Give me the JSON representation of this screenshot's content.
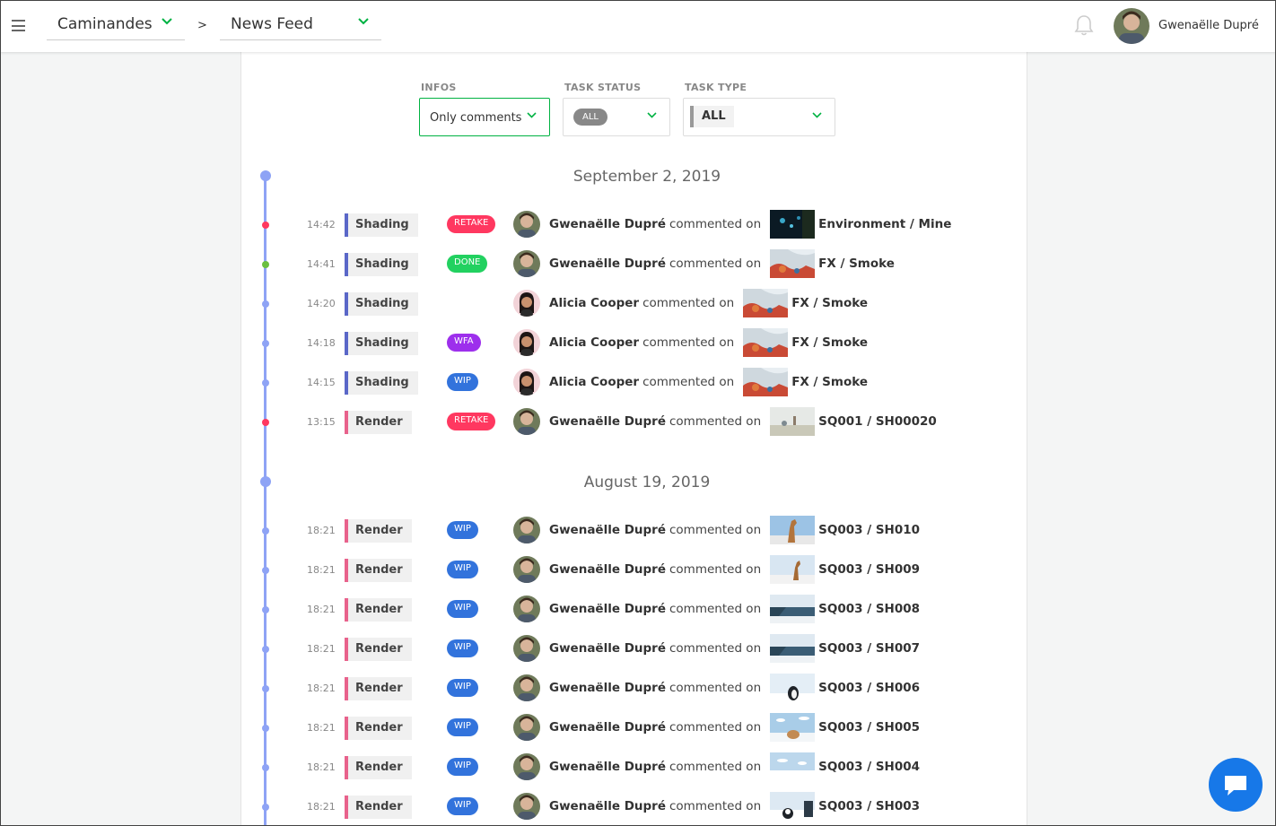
{
  "topbar": {
    "project": "Caminandes",
    "separator": ">",
    "section": "News Feed",
    "user_name": "Gwenaëlle Dupré"
  },
  "filters": {
    "infos": {
      "label": "INFOS",
      "value": "Only comments"
    },
    "task_status": {
      "label": "TASK STATUS",
      "value": "ALL"
    },
    "task_type": {
      "label": "TASK TYPE",
      "value": "ALL"
    }
  },
  "colors": {
    "accent": "#00b242",
    "timeline": "#8ea3f5",
    "shading": "#5a67c8",
    "render": "#e8628c",
    "retake": "#ff3860",
    "done": "#22d160",
    "wfa": "#9d2fec",
    "wip": "#3273dc",
    "chat": "#1778e8"
  },
  "groups": [
    {
      "date": "September 2, 2019",
      "items": [
        {
          "time": "14:42",
          "task": "Shading",
          "task_type": "shading",
          "status": "RETAKE",
          "status_key": "retake",
          "author": "Gwenaëlle Dupré",
          "author_key": "gwen",
          "verb": "commented on",
          "entity": "Environment / Mine",
          "thumb": "mine"
        },
        {
          "time": "14:41",
          "task": "Shading",
          "task_type": "shading",
          "status": "DONE",
          "status_key": "done",
          "author": "Gwenaëlle Dupré",
          "author_key": "gwen",
          "verb": "commented on",
          "entity": "FX / Smoke",
          "thumb": "smoke"
        },
        {
          "time": "14:20",
          "task": "Shading",
          "task_type": "shading",
          "status": "",
          "status_key": "",
          "author": "Alicia Cooper",
          "author_key": "alicia",
          "verb": "commented on",
          "entity": "FX / Smoke",
          "thumb": "smoke"
        },
        {
          "time": "14:18",
          "task": "Shading",
          "task_type": "shading",
          "status": "WFA",
          "status_key": "wfa",
          "author": "Alicia Cooper",
          "author_key": "alicia",
          "verb": "commented on",
          "entity": "FX / Smoke",
          "thumb": "smoke"
        },
        {
          "time": "14:15",
          "task": "Shading",
          "task_type": "shading",
          "status": "WIP",
          "status_key": "wip",
          "author": "Alicia Cooper",
          "author_key": "alicia",
          "verb": "commented on",
          "entity": "FX / Smoke",
          "thumb": "smoke"
        },
        {
          "time": "13:15",
          "task": "Render",
          "task_type": "render",
          "status": "RETAKE",
          "status_key": "retake",
          "author": "Gwenaëlle Dupré",
          "author_key": "gwen",
          "verb": "commented on",
          "entity": "SQ001 / SH00020",
          "thumb": "snow"
        }
      ]
    },
    {
      "date": "August 19, 2019",
      "items": [
        {
          "time": "18:21",
          "task": "Render",
          "task_type": "render",
          "status": "WIP",
          "status_key": "wip",
          "author": "Gwenaëlle Dupré",
          "author_key": "gwen",
          "verb": "commented on",
          "entity": "SQ003 / SH010",
          "thumb": "llama"
        },
        {
          "time": "18:21",
          "task": "Render",
          "task_type": "render",
          "status": "WIP",
          "status_key": "wip",
          "author": "Gwenaëlle Dupré",
          "author_key": "gwen",
          "verb": "commented on",
          "entity": "SQ003 / SH009",
          "thumb": "llama2"
        },
        {
          "time": "18:21",
          "task": "Render",
          "task_type": "render",
          "status": "WIP",
          "status_key": "wip",
          "author": "Gwenaëlle Dupré",
          "author_key": "gwen",
          "verb": "commented on",
          "entity": "SQ003 / SH008",
          "thumb": "sea"
        },
        {
          "time": "18:21",
          "task": "Render",
          "task_type": "render",
          "status": "WIP",
          "status_key": "wip",
          "author": "Gwenaëlle Dupré",
          "author_key": "gwen",
          "verb": "commented on",
          "entity": "SQ003 / SH007",
          "thumb": "sea"
        },
        {
          "time": "18:21",
          "task": "Render",
          "task_type": "render",
          "status": "WIP",
          "status_key": "wip",
          "author": "Gwenaëlle Dupré",
          "author_key": "gwen",
          "verb": "commented on",
          "entity": "SQ003 / SH006",
          "thumb": "penguin"
        },
        {
          "time": "18:21",
          "task": "Render",
          "task_type": "render",
          "status": "WIP",
          "status_key": "wip",
          "author": "Gwenaëlle Dupré",
          "author_key": "gwen",
          "verb": "commented on",
          "entity": "SQ003 / SH005",
          "thumb": "sky"
        },
        {
          "time": "18:21",
          "task": "Render",
          "task_type": "render",
          "status": "WIP",
          "status_key": "wip",
          "author": "Gwenaëlle Dupré",
          "author_key": "gwen",
          "verb": "commented on",
          "entity": "SQ003 / SH004",
          "thumb": "sky2"
        },
        {
          "time": "18:21",
          "task": "Render",
          "task_type": "render",
          "status": "WIP",
          "status_key": "wip",
          "author": "Gwenaëlle Dupré",
          "author_key": "gwen",
          "verb": "commented on",
          "entity": "SQ003 / SH003",
          "thumb": "penguin2"
        }
      ]
    }
  ]
}
